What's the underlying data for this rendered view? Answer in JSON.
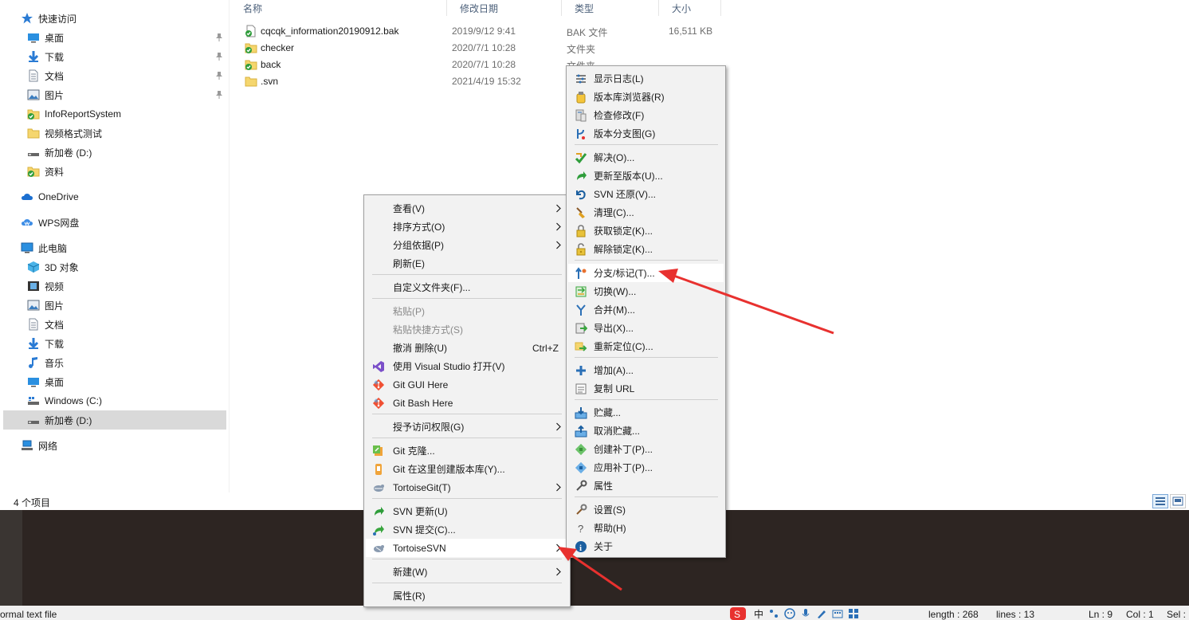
{
  "nav": {
    "items": [
      {
        "label": "快速访问",
        "icon": "star-icon",
        "pinned": false
      },
      {
        "label": "桌面",
        "icon": "desktop-icon",
        "pinned": true
      },
      {
        "label": "下载",
        "icon": "download-icon",
        "pinned": true
      },
      {
        "label": "文档",
        "icon": "document-icon",
        "pinned": true
      },
      {
        "label": "图片",
        "icon": "picture-icon",
        "pinned": true
      },
      {
        "label": "InfoReportSystem",
        "icon": "svn-folder-icon",
        "pinned": false
      },
      {
        "label": "视频格式测试",
        "icon": "folder-icon",
        "pinned": false
      },
      {
        "label": "新加卷 (D:)",
        "icon": "drive-icon",
        "pinned": false
      },
      {
        "label": "资料",
        "icon": "svn-folder-icon",
        "pinned": false
      },
      {
        "label": "OneDrive",
        "icon": "cloud-icon",
        "pinned": false
      },
      {
        "label": "WPS网盘",
        "icon": "wps-cloud-icon",
        "pinned": false
      },
      {
        "label": "此电脑",
        "icon": "computer-icon",
        "pinned": false
      },
      {
        "label": "3D 对象",
        "icon": "cube-icon",
        "pinned": false
      },
      {
        "label": "视频",
        "icon": "video-icon",
        "pinned": false
      },
      {
        "label": "图片",
        "icon": "picture-icon",
        "pinned": false
      },
      {
        "label": "文档",
        "icon": "document-icon",
        "pinned": false
      },
      {
        "label": "下载",
        "icon": "download-icon",
        "pinned": false
      },
      {
        "label": "音乐",
        "icon": "music-icon",
        "pinned": false
      },
      {
        "label": "桌面",
        "icon": "desktop-icon",
        "pinned": false
      },
      {
        "label": "Windows (C:)",
        "icon": "windows-drive-icon",
        "pinned": false
      },
      {
        "label": "新加卷 (D:)",
        "icon": "drive-icon",
        "pinned": false,
        "selected": true
      },
      {
        "label": "网络",
        "icon": "network-icon",
        "pinned": false
      }
    ]
  },
  "columns": {
    "name": "名称",
    "date": "修改日期",
    "type": "类型",
    "size": "大小"
  },
  "files": [
    {
      "name": "cqcqk_information20190912.bak",
      "date": "2019/9/12 9:41",
      "type": "BAK 文件",
      "size": "16,511 KB",
      "icon": "svn-file-icon"
    },
    {
      "name": "checker",
      "date": "2020/7/1 10:28",
      "type": "文件夹",
      "size": "",
      "icon": "svn-folder-icon"
    },
    {
      "name": "back",
      "date": "2020/7/1 10:28",
      "type": "文件夹",
      "size": "",
      "icon": "svn-folder-icon"
    },
    {
      "name": ".svn",
      "date": "2021/4/19 15:32",
      "type": "",
      "size": "",
      "icon": "folder-icon"
    }
  ],
  "status": {
    "item_count": "4 个项目"
  },
  "main_menu": {
    "items": [
      {
        "label": "查看(V)",
        "submenu": true
      },
      {
        "label": "排序方式(O)",
        "submenu": true
      },
      {
        "label": "分组依据(P)",
        "submenu": true
      },
      {
        "label": "刷新(E)"
      },
      {
        "label": "自定义文件夹(F)..."
      },
      {
        "label": "粘贴(P)",
        "disabled": true
      },
      {
        "label": "粘贴快捷方式(S)",
        "disabled": true
      },
      {
        "label": "撤消 删除(U)",
        "shortcut": "Ctrl+Z"
      },
      {
        "label": "使用 Visual Studio 打开(V)",
        "icon": "visual-studio-icon"
      },
      {
        "label": "Git GUI Here",
        "icon": "git-icon"
      },
      {
        "label": "Git Bash Here",
        "icon": "git-icon"
      },
      {
        "label": "授予访问权限(G)",
        "submenu": true
      },
      {
        "label": "Git 克隆...",
        "icon": "git-clone-icon"
      },
      {
        "label": "Git 在这里创建版本库(Y)...",
        "icon": "git-init-icon"
      },
      {
        "label": "TortoiseGit(T)",
        "icon": "tortoisegit-icon",
        "submenu": true
      },
      {
        "label": "SVN 更新(U)",
        "icon": "svn-update-icon"
      },
      {
        "label": "SVN 提交(C)...",
        "icon": "svn-commit-icon"
      },
      {
        "label": "TortoiseSVN",
        "icon": "tortoisesvn-icon",
        "submenu": true,
        "hover": true
      },
      {
        "label": "新建(W)",
        "submenu": true
      },
      {
        "label": "属性(R)"
      }
    ]
  },
  "svn_menu": {
    "items": [
      {
        "label": "显示日志(L)",
        "icon": "log-icon"
      },
      {
        "label": "版本库浏览器(R)",
        "icon": "repo-browser-icon"
      },
      {
        "label": "检查修改(F)",
        "icon": "check-modifications-icon"
      },
      {
        "label": "版本分支图(G)",
        "icon": "revision-graph-icon"
      },
      {
        "label": "解决(O)...",
        "icon": "resolve-icon"
      },
      {
        "label": "更新至版本(U)...",
        "icon": "update-to-revision-icon"
      },
      {
        "label": "SVN 还原(V)...",
        "icon": "revert-icon"
      },
      {
        "label": "清理(C)...",
        "icon": "cleanup-icon"
      },
      {
        "label": "获取锁定(K)...",
        "icon": "lock-icon"
      },
      {
        "label": "解除锁定(K)...",
        "icon": "unlock-icon"
      },
      {
        "label": "分支/标记(T)...",
        "icon": "branch-tag-icon",
        "hover": true
      },
      {
        "label": "切换(W)...",
        "icon": "switch-icon"
      },
      {
        "label": "合并(M)...",
        "icon": "merge-icon"
      },
      {
        "label": "导出(X)...",
        "icon": "export-icon"
      },
      {
        "label": "重新定位(C)...",
        "icon": "relocate-icon"
      },
      {
        "label": "增加(A)...",
        "icon": "add-icon"
      },
      {
        "label": "复制 URL",
        "icon": "copy-url-icon"
      },
      {
        "label": "贮藏...",
        "icon": "shelve-icon"
      },
      {
        "label": "取消贮藏...",
        "icon": "unshelve-icon"
      },
      {
        "label": "创建补丁(P)...",
        "icon": "create-patch-icon"
      },
      {
        "label": "应用补丁(P)...",
        "icon": "apply-patch-icon"
      },
      {
        "label": "属性",
        "icon": "properties-icon"
      },
      {
        "label": "设置(S)",
        "icon": "settings-icon"
      },
      {
        "label": "帮助(H)",
        "icon": "help-icon"
      },
      {
        "label": "关于",
        "icon": "about-icon"
      }
    ]
  },
  "editor_status": {
    "file_type": "ormal text file",
    "length": "length : 268",
    "lines": "lines : 13",
    "ln": "Ln : 9",
    "col": "Col : 1",
    "sel": "Sel :",
    "ime": "中"
  },
  "colors": {
    "accent_arrow": "#e8312f",
    "editor_bg": "#2d2522",
    "hover_bg": "#ffffff",
    "menu_bg": "#f2f2f2"
  }
}
